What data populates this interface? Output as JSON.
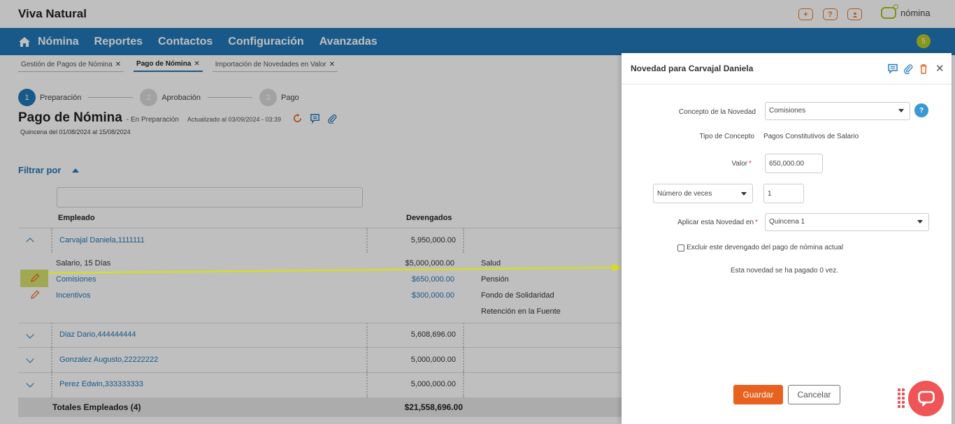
{
  "app": {
    "brand": "Viva Natural",
    "logo_text": "nómina",
    "notification_count": "5"
  },
  "nav": {
    "items": [
      "Nómina",
      "Reportes",
      "Contactos",
      "Configuración",
      "Avanzadas"
    ]
  },
  "tabs": [
    {
      "label": "Gestión de Pagos de Nómina",
      "active": false
    },
    {
      "label": "Pago de Nómina",
      "active": true
    },
    {
      "label": "Importación de Novedades en Valor",
      "active": false
    }
  ],
  "stepper": {
    "steps": [
      {
        "number": "1",
        "label": "Preparación"
      },
      {
        "number": "2",
        "label": "Aprobación"
      },
      {
        "number": "3",
        "label": "Pago"
      }
    ]
  },
  "page": {
    "title": "Pago de Nómina",
    "status": "- En Preparación",
    "updated": "Actualizado al 03/09/2024 - 03:39",
    "subtitle": "Quincena del 01/08/2024 al 15/08/2024",
    "filter_label": "Filtrar por"
  },
  "table": {
    "headers": {
      "employee": "Empleado",
      "accrued": "Devengados"
    },
    "rows": [
      {
        "name": "Carvajal Daniela,1111111",
        "accrued": "5,950,000.00"
      },
      {
        "name": "Diaz Dario,444444444",
        "accrued": "5,608,696.00"
      },
      {
        "name": "Gonzalez Augusto,22222222",
        "accrued": "5,000,000.00"
      },
      {
        "name": "Perez Edwin,333333333",
        "accrued": "5,000,000.00"
      }
    ],
    "detail": {
      "items": [
        {
          "label": "Salario, 15 Días",
          "value": "$5,000,000.00"
        },
        {
          "label": "Comisiones",
          "value": "$650,000.00"
        },
        {
          "label": "Incentivos",
          "value": "$300,000.00"
        }
      ],
      "deductions": [
        "Salud",
        "Pensión",
        "Fondo de Solidaridad",
        "Retención en la Fuente"
      ]
    },
    "totals": {
      "label": "Totales Empleados (4)",
      "value": "$21,558,696.00"
    }
  },
  "drawer": {
    "title": "Novedad para Carvajal Daniela",
    "concepto_label": "Concepto de la Novedad",
    "concepto_value": "Comisiones",
    "tipo_label": "Tipo de Concepto",
    "tipo_value": "Pagos Constitutivos de Salario",
    "valor_label": "Valor",
    "valor_value": "650,000.00",
    "veces_select": "Número de veces",
    "veces_value": "1",
    "aplicar_label": "Aplicar esta Novedad en",
    "aplicar_value": "Quincena 1",
    "excluir_label": "Excluir este devengado del pago de nómina actual",
    "paid_info": "Esta novedad se ha pagado 0 vez.",
    "save_label": "Guardar",
    "cancel_label": "Cancelar"
  },
  "colors": {
    "primary": "#2277b7",
    "accent": "#e8611e",
    "annotation": "#d6e06e"
  }
}
